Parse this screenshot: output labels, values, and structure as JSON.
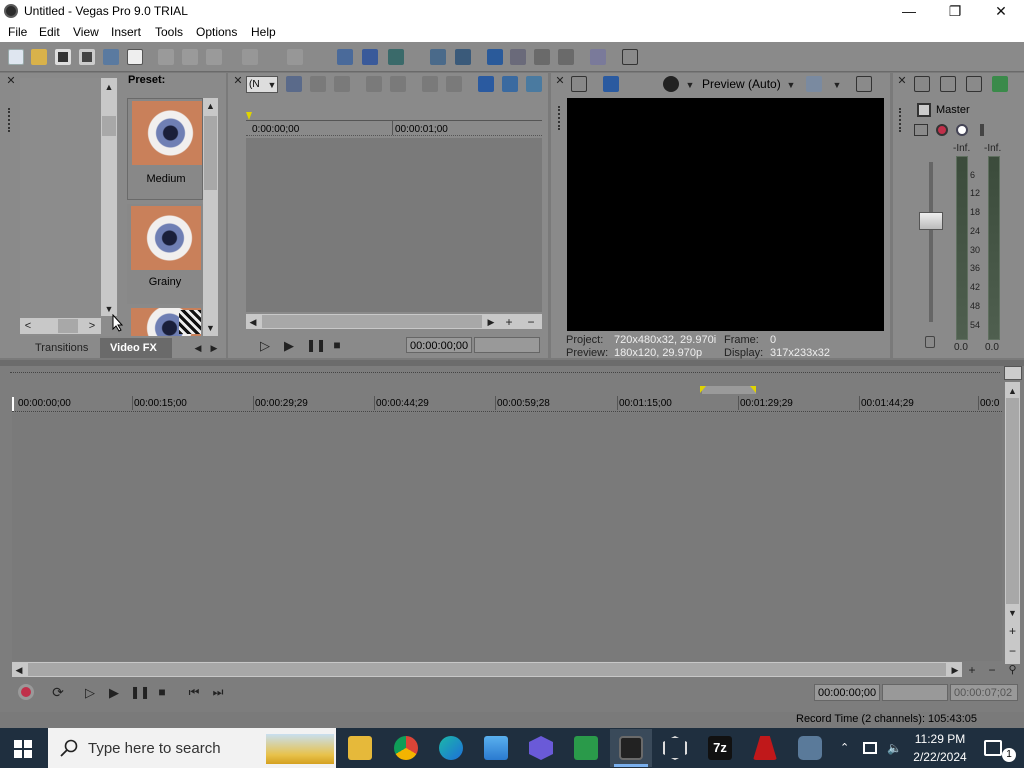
{
  "window": {
    "title": "Untitled - Vegas Pro 9.0 TRIAL"
  },
  "menu": [
    "File",
    "Edit",
    "View",
    "Insert",
    "Tools",
    "Options",
    "Help"
  ],
  "explorer": {
    "preset_label": "Preset:",
    "presets": [
      "Medium",
      "Grainy"
    ],
    "tabs": [
      "Transitions",
      "Video FX"
    ]
  },
  "trimmer": {
    "time_start": "0:00:00;00",
    "time_1s": "00:00:01;00",
    "current_time": "00:00:00;00"
  },
  "preview": {
    "mode_label": "Preview (Auto)",
    "project_label": "Project:",
    "project_value": "720x480x32, 29.970i",
    "frame_label": "Frame:",
    "frame_value": "0",
    "preview_label": "Preview:",
    "preview_value": "180x120, 29.970p",
    "display_label": "Display:",
    "display_value": "317x233x32"
  },
  "mixer": {
    "master_label": "Master",
    "peak_left": "-Inf.",
    "peak_right": "-Inf.",
    "scale": [
      "6",
      "12",
      "18",
      "24",
      "30",
      "36",
      "42",
      "48",
      "54"
    ],
    "level_left": "0.0",
    "level_right": "0.0"
  },
  "timeline": {
    "ruler": [
      "00:00:00;00",
      "00:00:15;00",
      "00:00:29;29",
      "00:00:44;29",
      "00:00:59;28",
      "00:01:15;00",
      "00:01:29;29",
      "00:01:44;29",
      "00:0"
    ],
    "cursor_time": "00:00:00;00",
    "end_time": "00:00:07;02"
  },
  "status": {
    "record_time": "Record Time (2 channels): 105:43:05"
  },
  "taskbar": {
    "search_placeholder": "Type here to search",
    "time": "11:29 PM",
    "date": "2/22/2024",
    "notification_count": "1"
  },
  "colors": {
    "accent": "#1e6fd9",
    "panel": "#8a8a8a",
    "taskbar": "#1f2f3f"
  }
}
